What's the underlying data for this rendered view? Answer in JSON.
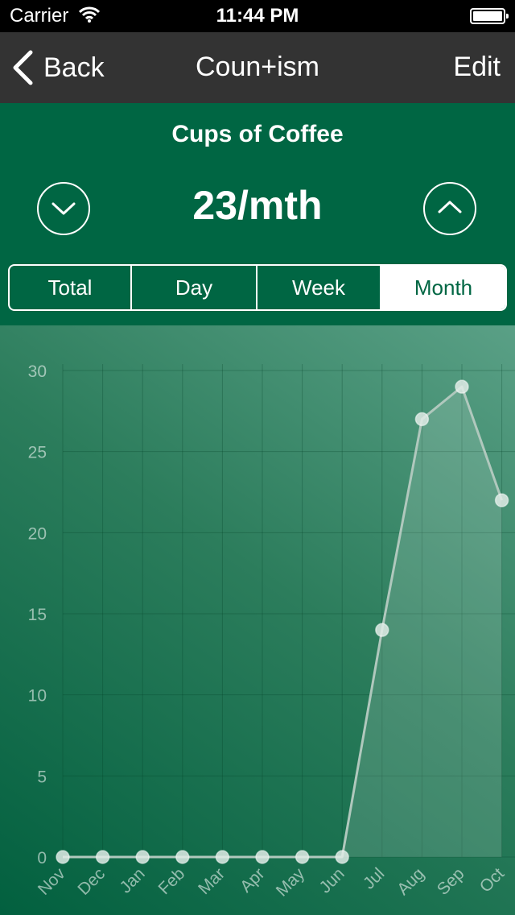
{
  "status_bar": {
    "carrier": "Carrier",
    "time": "11:44 PM"
  },
  "navbar": {
    "back_label": "Back",
    "title": "Coun+ism",
    "edit_label": "Edit"
  },
  "header": {
    "title": "Cups of Coffee",
    "rate": "23/mth"
  },
  "segments": [
    {
      "label": "Total",
      "active": false
    },
    {
      "label": "Day",
      "active": false
    },
    {
      "label": "Week",
      "active": false
    },
    {
      "label": "Month",
      "active": true
    }
  ],
  "colors": {
    "brand_green": "#006643",
    "navbar": "#333333",
    "line": "#b0c8bd"
  },
  "chart_data": {
    "type": "area",
    "x": [
      "Nov",
      "Dec",
      "Jan",
      "Feb",
      "Mar",
      "Apr",
      "May",
      "Jun",
      "Jul",
      "Aug",
      "Sep",
      "Oct"
    ],
    "values": [
      0,
      0,
      0,
      0,
      0,
      0,
      0,
      0,
      14,
      27,
      29,
      22
    ],
    "yticks": [
      0,
      5,
      10,
      15,
      20,
      25,
      30
    ],
    "ylim": [
      0,
      30
    ],
    "grid": true
  }
}
